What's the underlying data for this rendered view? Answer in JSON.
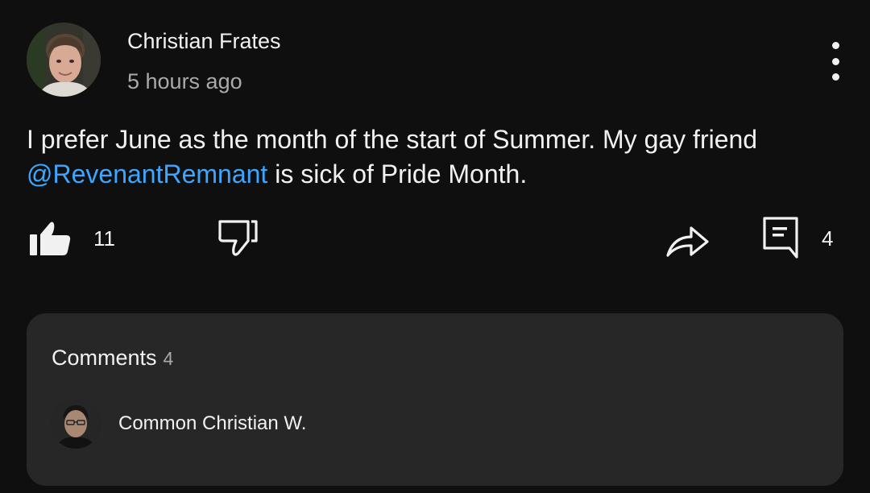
{
  "post": {
    "author": "Christian Frates",
    "timestamp": "5 hours ago",
    "text_before_mention": "I prefer June as the month of the start of Summer. My gay friend ",
    "mention": "@RevenantRemnant",
    "text_after_mention": " is sick of Pride Month.",
    "like_count": "11",
    "comment_count": "4"
  },
  "icons": {
    "menu": "more-vertical-icon",
    "like": "thumbs-up-icon",
    "dislike": "thumbs-down-icon",
    "share": "share-icon",
    "comment": "comment-icon"
  },
  "comments_card": {
    "title": "Comments",
    "count": "4",
    "preview_author": "Common Christian W."
  },
  "colors": {
    "background": "#0f0f0f",
    "card": "#272727",
    "text": "#f1f1f1",
    "secondary_text": "#aaaaaa",
    "mention": "#3ea6ff"
  }
}
